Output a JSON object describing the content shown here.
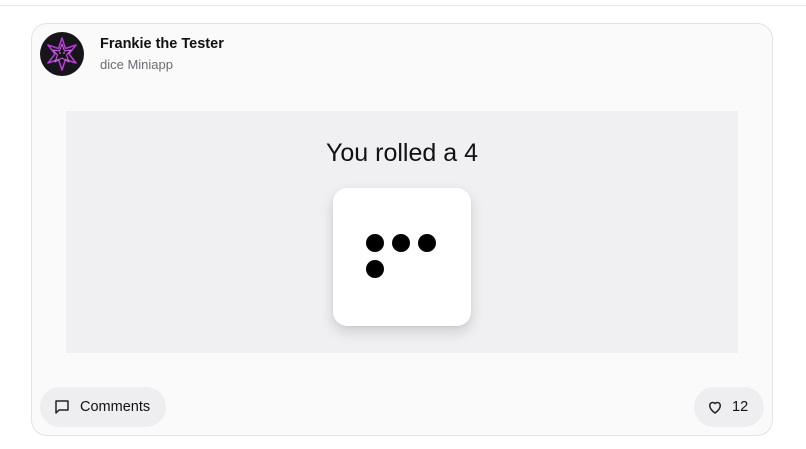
{
  "post": {
    "author_name": "Frankie the Tester",
    "app_label": "dice Miniapp",
    "avatar_icon": "purple-star-icon",
    "accent_color": "#b43ad8"
  },
  "miniapp": {
    "result_text": "You rolled a 4",
    "die_value": 4
  },
  "footer": {
    "comments_label": "Comments",
    "comments_icon": "message-square-icon",
    "like_count": "12",
    "like_icon": "heart-outline-icon"
  }
}
